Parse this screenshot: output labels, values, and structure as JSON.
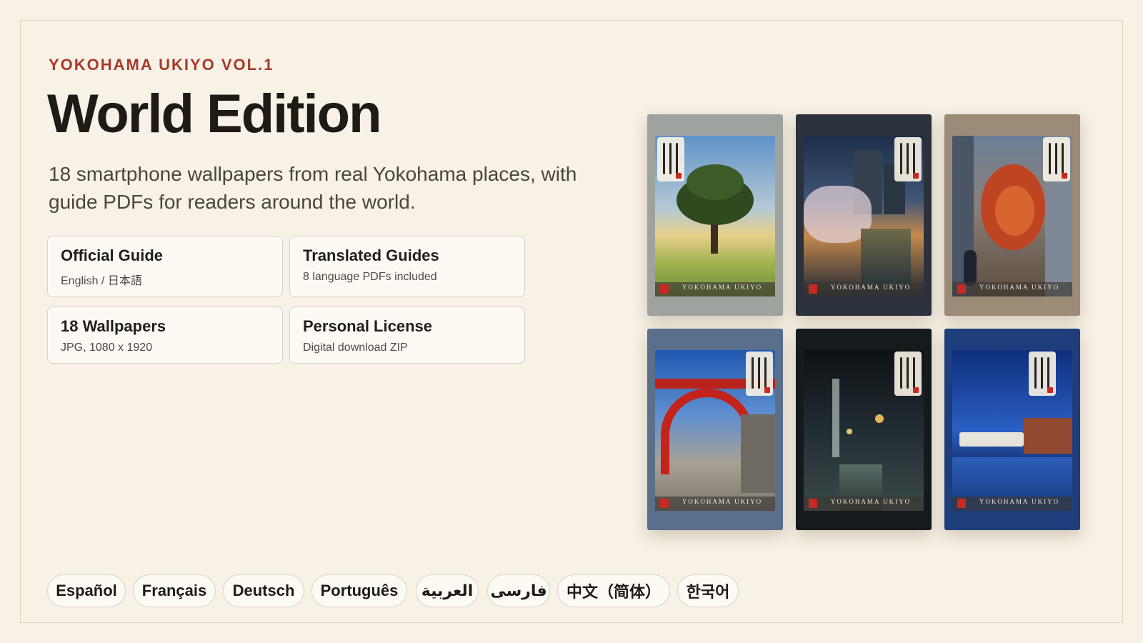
{
  "header": {
    "eyebrow": "YOKOHAMA UKIYO VOL.1",
    "title": "World Edition",
    "subtitle": "18 smartphone wallpapers from real Yokohama places, with guide PDFs for readers around the world."
  },
  "features": [
    {
      "title": "Official Guide",
      "subtitle": "English / 日本語"
    },
    {
      "title": "Translated Guides",
      "subtitle": "8 language PDFs included"
    },
    {
      "title": "18 Wallpapers",
      "subtitle": "JPG, 1080 x 1920"
    },
    {
      "title": "Personal License",
      "subtitle": "Digital download ZIP"
    }
  ],
  "gallery": {
    "brand_label": "YOKOHAMA UKIYO",
    "items": [
      {
        "scene": "park-tree-day",
        "colors": [
          "#6f9fc9",
          "#d9c27a",
          "#8fa84a"
        ]
      },
      {
        "scene": "cherry-blossom-river-night",
        "colors": [
          "#1f3250",
          "#c9b9c2",
          "#1a2433"
        ]
      },
      {
        "scene": "autumn-tree-street",
        "colors": [
          "#5b6f8a",
          "#c24a26",
          "#5a4a3c"
        ]
      },
      {
        "scene": "red-bridge-street",
        "colors": [
          "#2f64b3",
          "#c4211a",
          "#8a8174"
        ]
      },
      {
        "scene": "narrow-alley-night",
        "colors": [
          "#0f1418",
          "#3b4b4f",
          "#c9a65a"
        ]
      },
      {
        "scene": "harbor-brick-warehouse-night",
        "colors": [
          "#11398f",
          "#2c64c7",
          "#9c4a30"
        ]
      }
    ]
  },
  "languages": [
    "Español",
    "Français",
    "Deutsch",
    "Português",
    "العربية",
    "فارسی",
    "中文（简体）",
    "한국어"
  ],
  "colors": {
    "accent": "#a93a2b",
    "background": "#f7f1e6",
    "card": "#fdfaf4"
  }
}
